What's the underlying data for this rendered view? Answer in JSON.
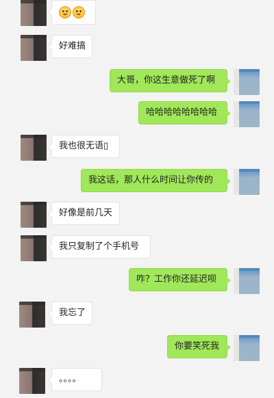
{
  "messages": [
    {
      "side": "left",
      "text": "",
      "emoji": [
        "smile-face",
        "smile-face"
      ]
    },
    {
      "side": "left",
      "text": "好难搞"
    },
    {
      "side": "right",
      "text": "大哥，你这生意做死了啊"
    },
    {
      "side": "right",
      "text": "哈哈哈哈哈哈哈哈"
    },
    {
      "side": "left",
      "text": "我也很无语▯"
    },
    {
      "side": "right",
      "text": "我这话，那人什么时间让你传的"
    },
    {
      "side": "left",
      "text": "好像是前几天"
    },
    {
      "side": "left",
      "text": "我只复制了个手机号"
    },
    {
      "side": "right",
      "text": "咋？工作你还延迟呗"
    },
    {
      "side": "left",
      "text": "我忘了"
    },
    {
      "side": "right",
      "text": "你要笑死我"
    },
    {
      "side": "left",
      "text": "。。。。"
    }
  ],
  "colors": {
    "background": "#f3f3f3",
    "bubble_left": "#ffffff",
    "bubble_right": "#a0e759",
    "text": "#222222"
  },
  "icons": {
    "emoji": "smiling-face-emoji",
    "avatar_left": "contact-avatar",
    "avatar_right": "self-avatar"
  }
}
